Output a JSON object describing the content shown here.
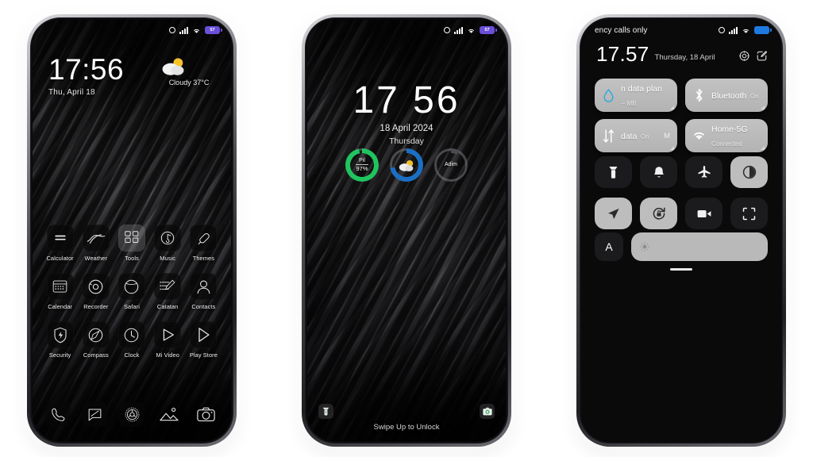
{
  "page": {
    "background": "#ffffff",
    "phone_count": 3
  },
  "phone_home": {
    "name": "home-screen",
    "statusbar": {
      "left_text": "",
      "icons": [
        "ring-icon",
        "signal-icon",
        "wifi-icon",
        "battery-icon"
      ],
      "battery_color": "#6a4fd8",
      "battery_text": "57"
    },
    "clock": {
      "time": "17:56",
      "date": "Thu, April 18"
    },
    "weather": {
      "icon": "partly-cloudy-icon",
      "text": "Cloudy  37°C"
    },
    "apps": [
      {
        "label": "Calculator",
        "icon": "calculator-icon",
        "translucent": false
      },
      {
        "label": "Weather",
        "icon": "weather-icon",
        "translucent": false
      },
      {
        "label": "Tools",
        "icon": "tools-folder-icon",
        "translucent": true
      },
      {
        "label": "Music",
        "icon": "music-icon",
        "translucent": false
      },
      {
        "label": "Themes",
        "icon": "themes-icon",
        "translucent": false
      },
      {
        "label": "Calendar",
        "icon": "calendar-icon",
        "translucent": false
      },
      {
        "label": "Recorder",
        "icon": "recorder-icon",
        "translucent": false
      },
      {
        "label": "Safari",
        "icon": "safari-icon",
        "translucent": false
      },
      {
        "label": "Catatan",
        "icon": "notes-icon",
        "translucent": false
      },
      {
        "label": "Contacts",
        "icon": "contacts-icon",
        "translucent": false
      },
      {
        "label": "Security",
        "icon": "security-shield-icon",
        "translucent": false
      },
      {
        "label": "Compass",
        "icon": "compass-icon",
        "translucent": false
      },
      {
        "label": "Clock",
        "icon": "clock-icon",
        "translucent": false
      },
      {
        "label": "Mi Video",
        "icon": "video-play-icon",
        "translucent": false
      },
      {
        "label": "Play Store",
        "icon": "play-store-icon",
        "translucent": false
      }
    ],
    "dock": [
      {
        "name": "phone-icon",
        "plain": false
      },
      {
        "name": "messages-icon",
        "plain": false
      },
      {
        "name": "browser-icon",
        "plain": false
      },
      {
        "name": "gallery-icon",
        "plain": true
      },
      {
        "name": "camera-icon",
        "plain": true
      }
    ]
  },
  "phone_lock": {
    "name": "lock-screen",
    "statusbar": {
      "left_text": "",
      "battery_color": "#6a4fd8",
      "battery_text": "57"
    },
    "time": "17 56",
    "date": "18 April 2024",
    "weekday": "Thursday",
    "widgets": [
      {
        "name": "battery-widget",
        "line1": "Pil",
        "line2": "97%",
        "ring_color": "#1fc45e",
        "progress": 97
      },
      {
        "name": "weather-widget",
        "line1": "",
        "line2": "",
        "ring_color": "#1a6fc4",
        "progress": 72,
        "icon": "partly-cloudy-icon"
      },
      {
        "name": "steps-widget",
        "line1": "Adim",
        "line2": "",
        "ring_color": "#4a4a50",
        "progress": 8
      }
    ],
    "hint": "Swipe Up to Unlock",
    "corner_left": "flashlight-icon",
    "corner_right": "camera-icon"
  },
  "phone_quick": {
    "name": "quick-settings",
    "statusbar": {
      "left_text": "ency calls only",
      "battery_color": "#1f7ae0",
      "battery_text": ""
    },
    "time": "17.57",
    "date": "Thursday, 18 April",
    "header_icons": [
      "settings-gear-icon",
      "edit-icon"
    ],
    "tiles": [
      {
        "icon": "data-usage-drop-icon",
        "title": "n data plan",
        "sub": "-- MB",
        "right": "",
        "icon_color": "#29a8e0"
      },
      {
        "icon": "bluetooth-icon",
        "title": "Bluetooth",
        "sub": "On",
        "right": "",
        "icon_color": "#ffffff"
      },
      {
        "icon": "mobile-data-icon",
        "title": "data",
        "sub": "On",
        "right": "M",
        "icon_color": "#ffffff"
      },
      {
        "icon": "wifi-icon",
        "title": "Home-5G",
        "sub": "Connected",
        "right": "",
        "icon_color": "#ffffff"
      }
    ],
    "toggles": [
      {
        "name": "flashlight-toggle",
        "icon": "flashlight-icon",
        "on": false
      },
      {
        "name": "ringer-toggle",
        "icon": "bell-icon",
        "on": false
      },
      {
        "name": "airplane-toggle",
        "icon": "airplane-icon",
        "on": false
      },
      {
        "name": "dark-mode-toggle",
        "icon": "contrast-icon",
        "on": true
      },
      {
        "name": "location-toggle",
        "icon": "location-arrow-icon",
        "on": true
      },
      {
        "name": "rotation-lock-toggle",
        "icon": "rotation-lock-icon",
        "on": true
      },
      {
        "name": "screen-recorder-toggle",
        "icon": "video-camera-icon",
        "on": false
      },
      {
        "name": "scanner-toggle",
        "icon": "scan-frame-icon",
        "on": false
      }
    ],
    "auto_brightness_label": "A",
    "brightness": {
      "icon": "sun-icon",
      "value": 100
    }
  }
}
